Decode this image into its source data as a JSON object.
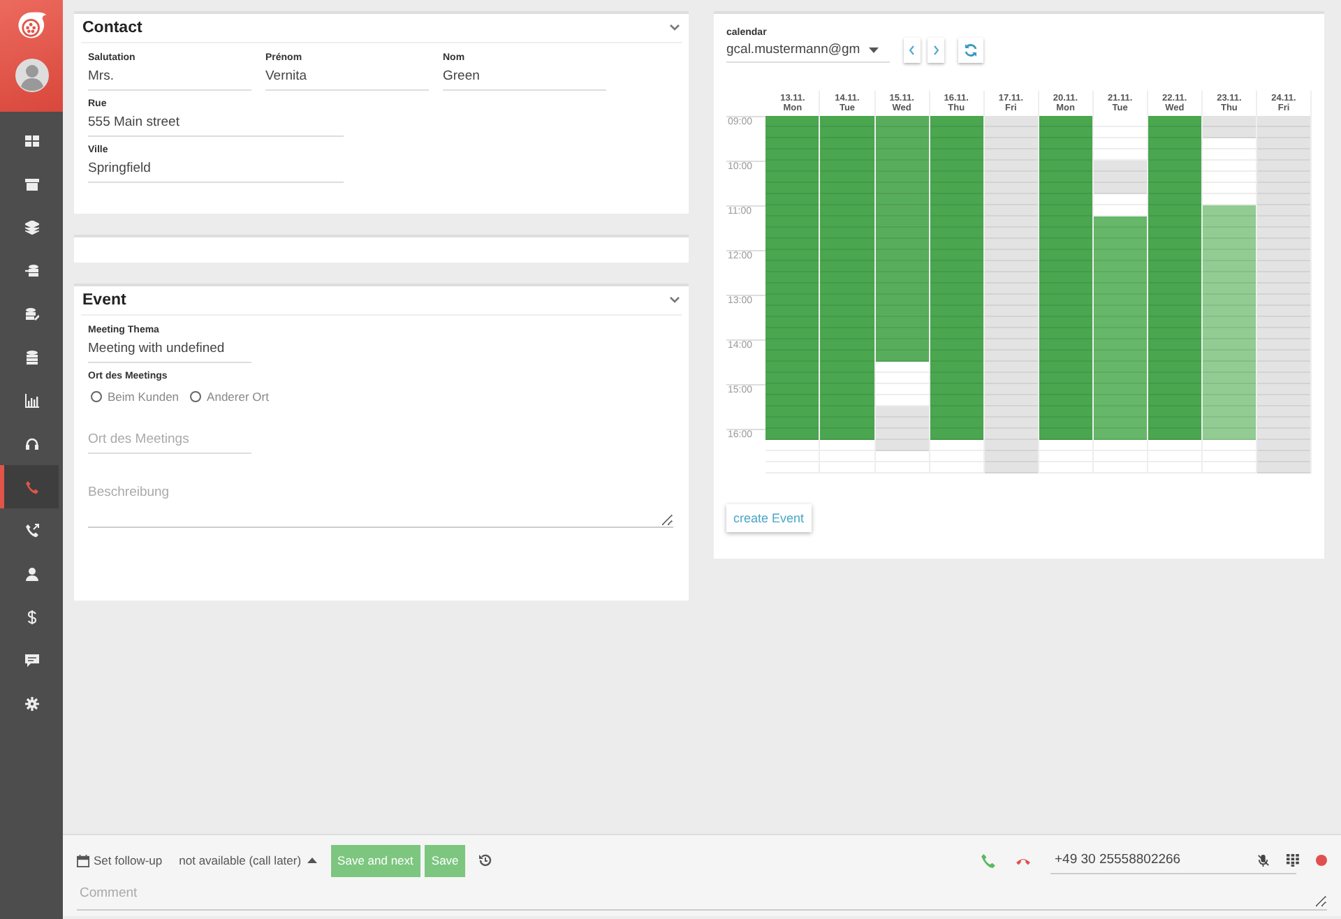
{
  "sidebar": {
    "items": [
      {
        "selected": false
      },
      {
        "selected": false
      },
      {
        "selected": false
      },
      {
        "selected": false
      },
      {
        "selected": false
      },
      {
        "selected": false
      },
      {
        "selected": false
      },
      {
        "selected": false
      },
      {
        "selected": true
      },
      {
        "selected": false
      },
      {
        "selected": false
      },
      {
        "selected": false
      },
      {
        "selected": false
      },
      {
        "selected": false
      }
    ]
  },
  "contact": {
    "title": "Contact",
    "rows": [
      [
        {
          "label": "Salutation",
          "value": "Mrs."
        },
        {
          "label": "Prénom",
          "value": "Vernita"
        },
        {
          "label": "Nom",
          "value": "Green"
        }
      ],
      [
        {
          "label": "Rue",
          "value": "555 Main street"
        }
      ],
      [
        {
          "label": "Ville",
          "value": "Springfield"
        }
      ]
    ]
  },
  "event": {
    "title": "Event",
    "theme": {
      "label": "Meeting Thema",
      "value": "Meeting with undefined"
    },
    "location_group": {
      "label": "Ort des Meetings",
      "options": [
        {
          "label": "Beim Kunden",
          "selected": false
        },
        {
          "label": "Anderer Ort",
          "selected": false
        }
      ]
    },
    "location": {
      "placeholder": "Ort des Meetings"
    },
    "description": {
      "placeholder": "Beschreibung"
    }
  },
  "calendar": {
    "label": "calendar",
    "account": "gcal.mustermann@gm",
    "create_button": "create Event",
    "times": [
      "09:00",
      "10:00",
      "11:00",
      "12:00",
      "13:00",
      "14:00",
      "15:00",
      "16:00"
    ],
    "days": [
      {
        "date": "13.11.",
        "weekday": "Mon",
        "slots": [
          {
            "kind": "busy"
          },
          {
            "kind": "busy"
          },
          {
            "kind": "busy"
          },
          {
            "kind": "busy"
          },
          {
            "kind": "busy"
          },
          {
            "kind": "busy"
          },
          {
            "kind": "busy"
          },
          {
            "kind": "busy"
          },
          {
            "kind": "busy"
          },
          {
            "kind": "busy"
          },
          {
            "kind": "busy"
          },
          {
            "kind": "busy"
          },
          {
            "kind": "busy"
          },
          {
            "kind": "busy"
          },
          {
            "kind": "busy"
          },
          {
            "kind": "busy"
          },
          {
            "kind": "busy"
          },
          {
            "kind": "busy"
          },
          {
            "kind": "busy"
          },
          {
            "kind": "busy"
          },
          {
            "kind": "busy"
          },
          {
            "kind": "busy"
          },
          {
            "kind": "busy"
          },
          {
            "kind": "busy"
          },
          {
            "kind": "busy"
          },
          {
            "kind": "busy"
          },
          {
            "kind": "busy"
          },
          {
            "kind": "busy"
          },
          {
            "kind": "busy"
          },
          {
            "kind": "free"
          },
          {
            "kind": "free"
          },
          {
            "kind": "free"
          }
        ]
      },
      {
        "date": "14.11.",
        "weekday": "Tue",
        "slots": [
          {
            "kind": "busy"
          },
          {
            "kind": "busy"
          },
          {
            "kind": "busy"
          },
          {
            "kind": "busy"
          },
          {
            "kind": "busy"
          },
          {
            "kind": "busy"
          },
          {
            "kind": "busy"
          },
          {
            "kind": "busy"
          },
          {
            "kind": "busy"
          },
          {
            "kind": "busy"
          },
          {
            "kind": "busy"
          },
          {
            "kind": "busy"
          },
          {
            "kind": "busy"
          },
          {
            "kind": "busy"
          },
          {
            "kind": "busy"
          },
          {
            "kind": "busy"
          },
          {
            "kind": "busy"
          },
          {
            "kind": "busy"
          },
          {
            "kind": "busy"
          },
          {
            "kind": "busy"
          },
          {
            "kind": "busy"
          },
          {
            "kind": "busy"
          },
          {
            "kind": "busy"
          },
          {
            "kind": "busy"
          },
          {
            "kind": "busy"
          },
          {
            "kind": "busy"
          },
          {
            "kind": "busy"
          },
          {
            "kind": "busy"
          },
          {
            "kind": "busy"
          },
          {
            "kind": "free"
          },
          {
            "kind": "free"
          },
          {
            "kind": "free"
          }
        ]
      },
      {
        "date": "15.11.",
        "weekday": "Wed",
        "slots": [
          {
            "kind": "booked"
          },
          {
            "kind": "booked"
          },
          {
            "kind": "booked"
          },
          {
            "kind": "booked"
          },
          {
            "kind": "booked"
          },
          {
            "kind": "booked"
          },
          {
            "kind": "booked"
          },
          {
            "kind": "booked"
          },
          {
            "kind": "booked"
          },
          {
            "kind": "booked"
          },
          {
            "kind": "booked"
          },
          {
            "kind": "booked"
          },
          {
            "kind": "booked"
          },
          {
            "kind": "booked"
          },
          {
            "kind": "booked"
          },
          {
            "kind": "booked"
          },
          {
            "kind": "booked"
          },
          {
            "kind": "booked"
          },
          {
            "kind": "booked"
          },
          {
            "kind": "booked"
          },
          {
            "kind": "booked"
          },
          {
            "kind": "booked"
          },
          {
            "kind": "free"
          },
          {
            "kind": "free"
          },
          {
            "kind": "free"
          },
          {
            "kind": "free"
          },
          {
            "kind": "blocked"
          },
          {
            "kind": "blocked"
          },
          {
            "kind": "blocked"
          },
          {
            "kind": "blocked"
          },
          {
            "kind": "free"
          },
          {
            "kind": "free"
          }
        ]
      },
      {
        "date": "16.11.",
        "weekday": "Thu",
        "slots": [
          {
            "kind": "busy"
          },
          {
            "kind": "busy"
          },
          {
            "kind": "busy"
          },
          {
            "kind": "busy"
          },
          {
            "kind": "busy"
          },
          {
            "kind": "busy"
          },
          {
            "kind": "busy"
          },
          {
            "kind": "busy"
          },
          {
            "kind": "busy"
          },
          {
            "kind": "busy"
          },
          {
            "kind": "busy"
          },
          {
            "kind": "busy"
          },
          {
            "kind": "busy"
          },
          {
            "kind": "busy"
          },
          {
            "kind": "busy"
          },
          {
            "kind": "busy"
          },
          {
            "kind": "busy"
          },
          {
            "kind": "busy"
          },
          {
            "kind": "busy"
          },
          {
            "kind": "busy"
          },
          {
            "kind": "busy"
          },
          {
            "kind": "busy"
          },
          {
            "kind": "busy"
          },
          {
            "kind": "busy"
          },
          {
            "kind": "busy"
          },
          {
            "kind": "busy"
          },
          {
            "kind": "busy"
          },
          {
            "kind": "busy"
          },
          {
            "kind": "busy"
          },
          {
            "kind": "free"
          },
          {
            "kind": "free"
          },
          {
            "kind": "free"
          }
        ]
      },
      {
        "date": "17.11.",
        "weekday": "Fri",
        "slots": [
          {
            "kind": "blocked"
          },
          {
            "kind": "blocked"
          },
          {
            "kind": "blocked"
          },
          {
            "kind": "blocked"
          },
          {
            "kind": "blocked"
          },
          {
            "kind": "blocked"
          },
          {
            "kind": "blocked"
          },
          {
            "kind": "blocked"
          },
          {
            "kind": "blocked"
          },
          {
            "kind": "blocked"
          },
          {
            "kind": "blocked"
          },
          {
            "kind": "blocked"
          },
          {
            "kind": "blocked"
          },
          {
            "kind": "blocked"
          },
          {
            "kind": "blocked"
          },
          {
            "kind": "blocked"
          },
          {
            "kind": "blocked"
          },
          {
            "kind": "blocked"
          },
          {
            "kind": "blocked"
          },
          {
            "kind": "blocked"
          },
          {
            "kind": "blocked"
          },
          {
            "kind": "blocked"
          },
          {
            "kind": "blocked"
          },
          {
            "kind": "blocked"
          },
          {
            "kind": "blocked"
          },
          {
            "kind": "blocked"
          },
          {
            "kind": "blocked"
          },
          {
            "kind": "blocked"
          },
          {
            "kind": "blocked"
          },
          {
            "kind": "blocked"
          },
          {
            "kind": "blocked"
          },
          {
            "kind": "blocked"
          }
        ]
      },
      {
        "date": "20.11.",
        "weekday": "Mon",
        "slots": [
          {
            "kind": "busy"
          },
          {
            "kind": "busy"
          },
          {
            "kind": "busy"
          },
          {
            "kind": "busy"
          },
          {
            "kind": "busy"
          },
          {
            "kind": "busy"
          },
          {
            "kind": "busy"
          },
          {
            "kind": "busy"
          },
          {
            "kind": "busy"
          },
          {
            "kind": "busy"
          },
          {
            "kind": "busy"
          },
          {
            "kind": "busy"
          },
          {
            "kind": "busy"
          },
          {
            "kind": "busy"
          },
          {
            "kind": "busy"
          },
          {
            "kind": "busy"
          },
          {
            "kind": "busy"
          },
          {
            "kind": "busy"
          },
          {
            "kind": "busy"
          },
          {
            "kind": "busy"
          },
          {
            "kind": "busy"
          },
          {
            "kind": "busy"
          },
          {
            "kind": "busy"
          },
          {
            "kind": "busy"
          },
          {
            "kind": "busy"
          },
          {
            "kind": "busy"
          },
          {
            "kind": "busy"
          },
          {
            "kind": "busy"
          },
          {
            "kind": "busy"
          },
          {
            "kind": "free"
          },
          {
            "kind": "free"
          },
          {
            "kind": "free"
          }
        ]
      },
      {
        "date": "21.11.",
        "weekday": "Tue",
        "slots": [
          {
            "kind": "free"
          },
          {
            "kind": "free"
          },
          {
            "kind": "free"
          },
          {
            "kind": "free"
          },
          {
            "kind": "blocked"
          },
          {
            "kind": "blocked"
          },
          {
            "kind": "blocked"
          },
          {
            "kind": "free"
          },
          {
            "kind": "free"
          },
          {
            "kind": "partial"
          },
          {
            "kind": "partial"
          },
          {
            "kind": "partial"
          },
          {
            "kind": "partial"
          },
          {
            "kind": "partial"
          },
          {
            "kind": "partial"
          },
          {
            "kind": "partial"
          },
          {
            "kind": "partial"
          },
          {
            "kind": "partial"
          },
          {
            "kind": "partial"
          },
          {
            "kind": "partial"
          },
          {
            "kind": "partial"
          },
          {
            "kind": "partial"
          },
          {
            "kind": "partial"
          },
          {
            "kind": "partial"
          },
          {
            "kind": "partial"
          },
          {
            "kind": "partial"
          },
          {
            "kind": "partial"
          },
          {
            "kind": "partial"
          },
          {
            "kind": "partial"
          },
          {
            "kind": "free"
          },
          {
            "kind": "free"
          },
          {
            "kind": "free"
          }
        ]
      },
      {
        "date": "22.11.",
        "weekday": "Wed",
        "slots": [
          {
            "kind": "busy"
          },
          {
            "kind": "busy"
          },
          {
            "kind": "busy"
          },
          {
            "kind": "busy"
          },
          {
            "kind": "busy"
          },
          {
            "kind": "busy"
          },
          {
            "kind": "busy"
          },
          {
            "kind": "busy"
          },
          {
            "kind": "busy"
          },
          {
            "kind": "busy"
          },
          {
            "kind": "busy"
          },
          {
            "kind": "busy"
          },
          {
            "kind": "busy"
          },
          {
            "kind": "busy"
          },
          {
            "kind": "busy"
          },
          {
            "kind": "busy"
          },
          {
            "kind": "busy"
          },
          {
            "kind": "busy"
          },
          {
            "kind": "busy"
          },
          {
            "kind": "busy"
          },
          {
            "kind": "busy"
          },
          {
            "kind": "busy"
          },
          {
            "kind": "busy"
          },
          {
            "kind": "busy"
          },
          {
            "kind": "busy"
          },
          {
            "kind": "busy"
          },
          {
            "kind": "busy"
          },
          {
            "kind": "busy"
          },
          {
            "kind": "busy"
          },
          {
            "kind": "free"
          },
          {
            "kind": "free"
          },
          {
            "kind": "free"
          }
        ]
      },
      {
        "date": "23.11.",
        "weekday": "Thu",
        "slots": [
          {
            "kind": "blocked"
          },
          {
            "kind": "blocked"
          },
          {
            "kind": "free"
          },
          {
            "kind": "free"
          },
          {
            "kind": "free"
          },
          {
            "kind": "free"
          },
          {
            "kind": "free"
          },
          {
            "kind": "free"
          },
          {
            "kind": "tentative"
          },
          {
            "kind": "tentative"
          },
          {
            "kind": "tentative"
          },
          {
            "kind": "tentative"
          },
          {
            "kind": "tentative"
          },
          {
            "kind": "tentative"
          },
          {
            "kind": "tentative"
          },
          {
            "kind": "tentative"
          },
          {
            "kind": "tentative"
          },
          {
            "kind": "tentative"
          },
          {
            "kind": "tentative"
          },
          {
            "kind": "tentative"
          },
          {
            "kind": "tentative"
          },
          {
            "kind": "tentative"
          },
          {
            "kind": "tentative"
          },
          {
            "kind": "tentative"
          },
          {
            "kind": "tentative"
          },
          {
            "kind": "tentative"
          },
          {
            "kind": "tentative"
          },
          {
            "kind": "tentative"
          },
          {
            "kind": "tentative"
          },
          {
            "kind": "free"
          },
          {
            "kind": "free"
          },
          {
            "kind": "free"
          }
        ]
      },
      {
        "date": "24.11.",
        "weekday": "Fri",
        "slots": [
          {
            "kind": "blocked"
          },
          {
            "kind": "blocked"
          },
          {
            "kind": "blocked"
          },
          {
            "kind": "blocked"
          },
          {
            "kind": "blocked"
          },
          {
            "kind": "blocked"
          },
          {
            "kind": "blocked"
          },
          {
            "kind": "blocked"
          },
          {
            "kind": "blocked"
          },
          {
            "kind": "blocked"
          },
          {
            "kind": "blocked"
          },
          {
            "kind": "blocked"
          },
          {
            "kind": "blocked"
          },
          {
            "kind": "blocked"
          },
          {
            "kind": "blocked"
          },
          {
            "kind": "blocked"
          },
          {
            "kind": "blocked"
          },
          {
            "kind": "blocked"
          },
          {
            "kind": "blocked"
          },
          {
            "kind": "blocked"
          },
          {
            "kind": "blocked"
          },
          {
            "kind": "blocked"
          },
          {
            "kind": "blocked"
          },
          {
            "kind": "blocked"
          },
          {
            "kind": "blocked"
          },
          {
            "kind": "blocked"
          },
          {
            "kind": "blocked"
          },
          {
            "kind": "blocked"
          },
          {
            "kind": "blocked"
          },
          {
            "kind": "blocked"
          },
          {
            "kind": "blocked"
          },
          {
            "kind": "blocked"
          }
        ]
      }
    ]
  },
  "bottom_bar": {
    "follow_up": "Set follow-up",
    "status": "not available (call later)",
    "save_next": "Save and next",
    "save": "Save",
    "phone_number": "+49 30 25558802266",
    "comment": {
      "placeholder": "Comment"
    }
  }
}
